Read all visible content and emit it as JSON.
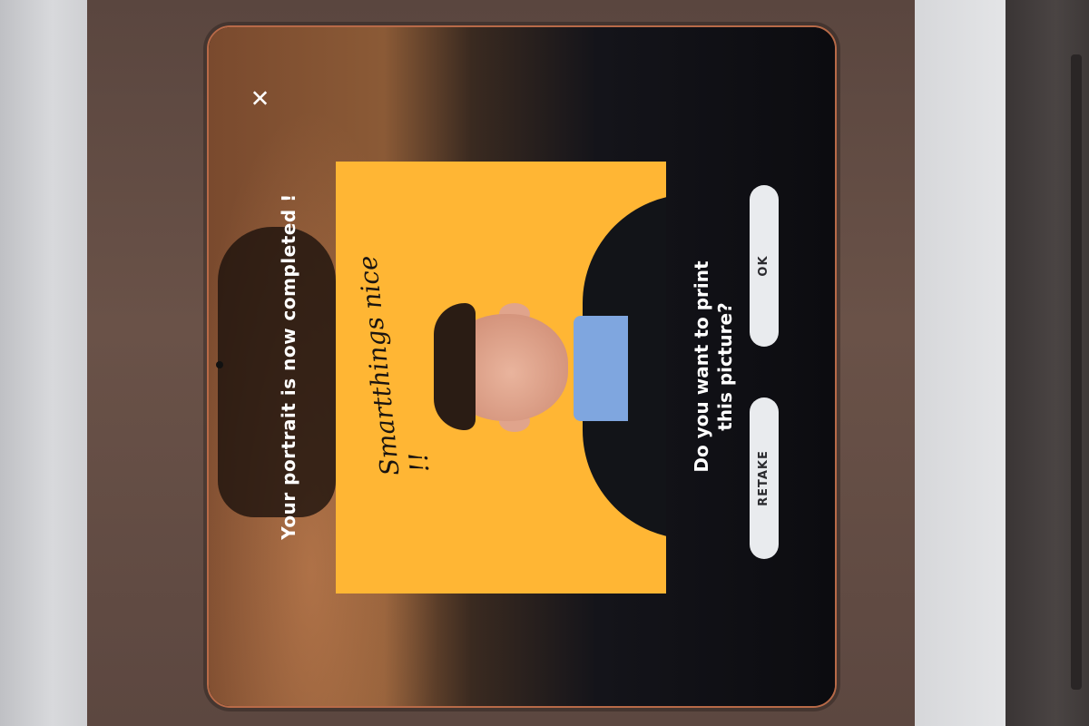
{
  "window": {
    "close_glyph": "✕"
  },
  "header": {
    "title": "Your portrait is now completed !"
  },
  "portrait": {
    "caption": "Smartthings nice !!",
    "background_color": "#ffb634"
  },
  "prompt": {
    "line1": "Do you want to print",
    "line2": "this picture?"
  },
  "actions": {
    "retake_label": "RETAKE",
    "ok_label": "OK"
  }
}
